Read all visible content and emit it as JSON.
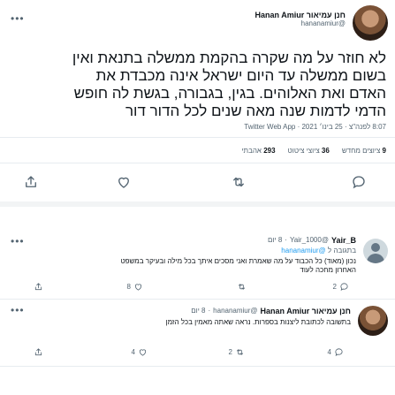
{
  "main_tweet": {
    "author_name": "חנן עמיאור Hanan Amiur",
    "author_handle": "@hananamiur",
    "more_glyph": "•••",
    "text_lines": [
      "לא חוזר על מה שקרה בהקמת ממשלה בתנאת ואין",
      "בשום ממשלה עד היום ישראל אינה מכבדת את",
      "האדם ואת האלוהים. בגין, בגבורה, בגשת לה חופש",
      "הדמי לדמות שנה מאה שנים לכל הדור דור"
    ],
    "timestamp": "8:07 לפנה\"צ · 25 בינו׳ 2021 · Twitter Web App",
    "stats": {
      "retweets_count": "9",
      "retweets_label": "ציוצים מחדש",
      "quotes_count": "36",
      "quotes_label": "ציוצי ציטוט",
      "likes_count": "293",
      "likes_label": "אהבתי"
    }
  },
  "reply1": {
    "author_name": "Yair_B",
    "author_handle": "@Yair_1000",
    "time": "8 יום",
    "replying_label": "בתגובה ל",
    "replying_to": "@hananamiur",
    "text_lines": [
      "נכון (מאוד) כל הכבוד על מה שאמרת ואני מסכים איתך בכל מילה ובעיקר במשפט",
      "האחרון מחכה לעוד"
    ],
    "reply_count": "2",
    "retweet_count": "",
    "like_count": "8"
  },
  "reply2": {
    "author_name": "חנן עמיאור Hanan Amiur",
    "author_handle": "@hananamiur",
    "time": "8 יום",
    "text_lines": [
      "בתשובה לכתובת ליצנות בספרות. נראה שאתה מאמין בכל הזמן"
    ],
    "reply_count": "4",
    "retweet_count": "2",
    "like_count": "4"
  },
  "colors": {
    "accent": "#1d9bf0",
    "muted": "#536471",
    "divider": "#e7ecf0"
  }
}
